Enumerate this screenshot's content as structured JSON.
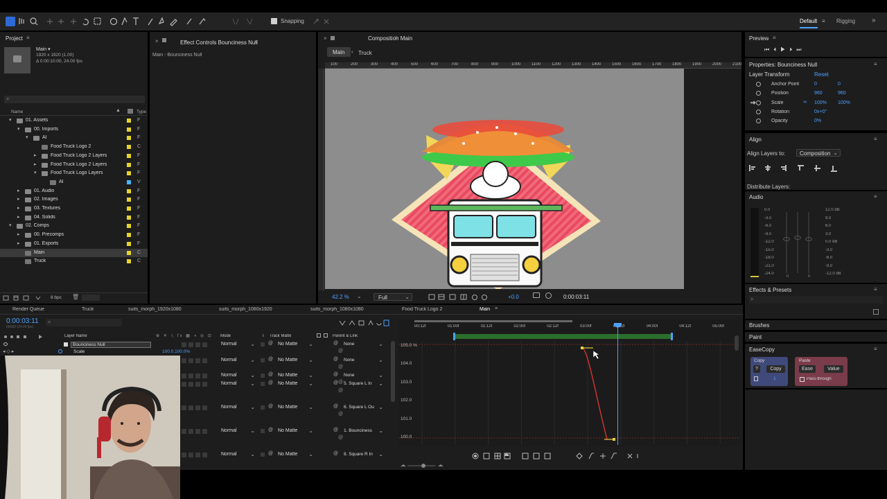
{
  "toolbar": {
    "snapping_label": "Snapping",
    "workspace_default": "Default",
    "workspace_rigging": "Rigging"
  },
  "project": {
    "title": "Project",
    "comp_name": "Main ▾",
    "comp_size": "1920 x 1920 (1.00)",
    "comp_duration": "Δ 0:00:10:00, 24.00 fps",
    "search_placeholder": "",
    "col_name": "Name",
    "col_type": "Type",
    "items": [
      {
        "name": "01. Assets",
        "indent": 0,
        "arrow": "▾",
        "type": "F",
        "color": "#e8d22f",
        "folder": true
      },
      {
        "name": "00. Imports",
        "indent": 1,
        "arrow": "▾",
        "type": "F",
        "color": "#e8d22f",
        "folder": true
      },
      {
        "name": "AI",
        "indent": 2,
        "arrow": "▾",
        "type": "F",
        "color": "#e8d22f",
        "folder": true
      },
      {
        "name": "Food Truck Logo 2",
        "indent": 3,
        "arrow": "",
        "type": "C",
        "color": "#e8d22f",
        "folder": false
      },
      {
        "name": "Food Truck Logo 2 Layers",
        "indent": 3,
        "arrow": "▸",
        "type": "F",
        "color": "#e8d22f",
        "folder": true
      },
      {
        "name": "Food Truck Logo 2 Layers",
        "indent": 3,
        "arrow": "▸",
        "type": "F",
        "color": "#e8d22f",
        "folder": true
      },
      {
        "name": "Food Truck Logo Layers",
        "indent": 3,
        "arrow": "▾",
        "type": "F",
        "color": "#e8d22f",
        "folder": true
      },
      {
        "name": "AI",
        "indent": 4,
        "arrow": "",
        "type": "V",
        "color": "#47b6ff",
        "folder": false
      },
      {
        "name": "01. Audio",
        "indent": 1,
        "arrow": "▸",
        "type": "F",
        "color": "#e8d22f",
        "folder": true
      },
      {
        "name": "02. Images",
        "indent": 1,
        "arrow": "▸",
        "type": "F",
        "color": "#e8d22f",
        "folder": true
      },
      {
        "name": "03. Textures",
        "indent": 1,
        "arrow": "▸",
        "type": "F",
        "color": "#e8d22f",
        "folder": true
      },
      {
        "name": "04. Solids",
        "indent": 1,
        "arrow": "▸",
        "type": "F",
        "color": "#e8d22f",
        "folder": true
      },
      {
        "name": "02. Comps",
        "indent": 0,
        "arrow": "▾",
        "type": "F",
        "color": "#e8d22f",
        "folder": true
      },
      {
        "name": "00. Precomps",
        "indent": 1,
        "arrow": "▸",
        "type": "F",
        "color": "#e8d22f",
        "folder": true
      },
      {
        "name": "01. Exports",
        "indent": 1,
        "arrow": "▸",
        "type": "F",
        "color": "#e8d22f",
        "folder": true
      },
      {
        "name": "Main",
        "indent": 1,
        "arrow": "",
        "type": "C",
        "color": "#e8d22f",
        "folder": false,
        "selected": true
      },
      {
        "name": "Truck",
        "indent": 1,
        "arrow": "",
        "type": "C",
        "color": "#e8d22f",
        "folder": false
      }
    ],
    "bpc": "8 bpc"
  },
  "effect_controls": {
    "title": "Effect Controls Bounciness Null",
    "subtitle": "Main - Bounciness Null"
  },
  "composition": {
    "title": "Composition Main",
    "tabs": [
      "Main",
      "Truck"
    ],
    "ruler_labels": [
      "100",
      "200",
      "300",
      "400",
      "500",
      "600",
      "700",
      "800",
      "900",
      "1000",
      "1100",
      "1200",
      "1300",
      "1400",
      "1500",
      "1600",
      "1700",
      "1800",
      "1900",
      "2000",
      "2100"
    ],
    "zoom": "42.2 %",
    "resolution": "Full",
    "exposure": "+0.0",
    "timecode": "0:00:03:11"
  },
  "preview": {
    "title": "Preview"
  },
  "properties": {
    "title": "Properties: Bounciness Null",
    "section": "Layer Transform",
    "reset": "Reset",
    "rows": [
      {
        "label": "Anchor Point",
        "v1": "0",
        "v2": "0"
      },
      {
        "label": "Position",
        "v1": "960",
        "v2": "960"
      },
      {
        "label": "Scale",
        "v1": "100%",
        "v2": "100%"
      },
      {
        "label": "Rotation",
        "v1": "0x+0°",
        "v2": ""
      },
      {
        "label": "Opacity",
        "v1": "0%",
        "v2": ""
      }
    ]
  },
  "align": {
    "title": "Align",
    "align_to_label": "Align Layers to:",
    "align_to_value": "Composition",
    "distribute": "Distribute Layers:"
  },
  "audio": {
    "title": "Audio",
    "left_scale": [
      "0.0",
      "-3.0",
      "-6.0",
      "-9.0",
      "-12.0",
      "-15.0",
      "-18.0",
      "-21.0",
      "-24.0"
    ],
    "right_scale": [
      "12.0 dB",
      "9.0",
      "6.0",
      "3.0",
      "0.0 dB",
      "-3.0",
      "-6.0",
      "-9.0",
      "-12.0 dB"
    ],
    "zero_a": "0",
    "zero_b": "0"
  },
  "effects_presets": {
    "title": "Effects & Presets"
  },
  "brushes": {
    "title": "Brushes"
  },
  "paint": {
    "title": "Paint"
  },
  "easecopy": {
    "title": "EaseCopy",
    "copy_label": "Copy",
    "copy_button": "Copy",
    "help": "?",
    "copy_count": "1",
    "paste_label": "Paste",
    "ease_button": "Ease",
    "value_button": "Value",
    "passthrough": "Pass-through"
  },
  "timeline": {
    "tabs": [
      "Render Queue",
      "Truck",
      "suits_morph_1920x1080",
      "suits_morph_1080x1920",
      "suits_morph_1080x1080",
      "Food Truck Logo 2",
      "Main"
    ],
    "timecode": "0:00:03:11",
    "timecode_sub": "00083 (24.00 fps)",
    "col_layer": "Layer Name",
    "col_mode": "Mode",
    "col_t": "T",
    "col_matte": "Track Matte",
    "col_parent": "Parent & Link",
    "layers": [
      {
        "name": "Bounciness Null",
        "mode": "Normal",
        "matte": "No Matte",
        "parent": "None",
        "sub": "Scale",
        "sub_value": "100.0,100.0%"
      },
      {
        "name": "",
        "mode": "Normal",
        "matte": "No Matte",
        "parent": "None"
      },
      {
        "name": "",
        "mode": "Normal",
        "matte": "No Matte",
        "parent": "None"
      },
      {
        "name": "",
        "mode": "Normal",
        "matte": "No Matte",
        "parent": "5. Square L In"
      },
      {
        "name": "",
        "mode": "Normal",
        "matte": "No Matte",
        "parent": "6. Square L Ou"
      },
      {
        "name": "",
        "mode": "Normal",
        "matte": "No Matte",
        "parent": "1. Bounciness"
      },
      {
        "name": "",
        "mode": "Normal",
        "matte": "No Matte",
        "parent": "8. Square R In"
      }
    ],
    "time_labels": [
      "00:12f",
      "01:00f",
      "01:12f",
      "02:00f",
      "02:12f",
      "03:00f",
      "03:12f",
      "04:00f",
      "04:12f",
      "05:00f"
    ],
    "graph_labels": [
      "105.0 %",
      "104.0",
      "103.0",
      "102.0",
      "101.0",
      "100.0"
    ]
  }
}
